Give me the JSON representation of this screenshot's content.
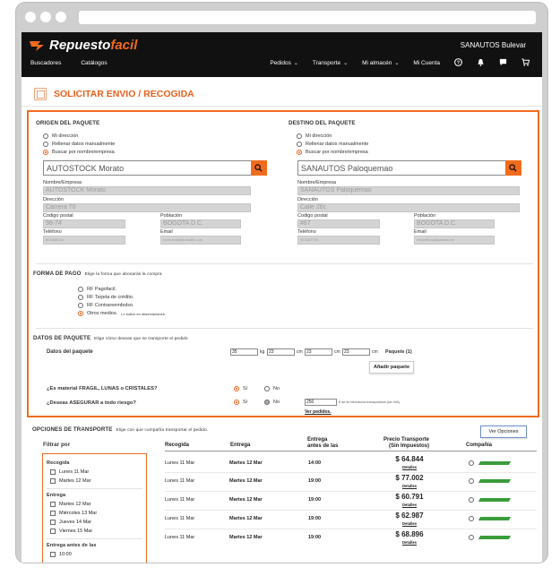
{
  "header": {
    "logo_left": "Repuesto",
    "logo_right": "facil",
    "user": "SANAUTOS Bulevar",
    "nav_left": [
      "Buscadores",
      "Catálogos"
    ],
    "nav_right": [
      "Pedidos",
      "Transporte",
      "Mi almacén",
      "Mi Cuenta"
    ]
  },
  "page": {
    "title": "SOLICITAR ENVIO / RECOGIDA"
  },
  "origen": {
    "title": "ORIGEN DEL PAQUETE",
    "options": [
      "Mi dirección",
      "Rellenar datos manualmente",
      "Buscar por nombre/empresa"
    ],
    "selected": 2,
    "search_value": "AUTOSTOCK Morato",
    "labels": {
      "nombre": "Nombre/Empresa",
      "direccion": "Dirección",
      "cp": "Codigo postal",
      "poblacion": "Población",
      "telefono": "Teléfono",
      "email": "Email"
    },
    "values": {
      "nombre": "AUTOSTOCK Morato",
      "direccion": "Carrera 70",
      "cp": "98-74",
      "poblacion": "BOGOTA D.C.",
      "telefono": "602488002",
      "email": "comercial@autos88.com"
    }
  },
  "destino": {
    "title": "DESTINO DEL PAQUETE",
    "options": [
      "Mi dirección",
      "Rellenar datos manualmente",
      "Buscar por nombre/empresa"
    ],
    "selected": 2,
    "search_value": "SANAUTOS Paloquemao",
    "labels": {
      "nombre": "Nombre/Empresa",
      "direccion": "Dirección",
      "cp": "Codigo postal",
      "poblacion": "Población",
      "telefono": "Teléfono",
      "email": "Email"
    },
    "values": {
      "nombre": "SANAUTOS Paloquemao",
      "direccion": "Calle 26c",
      "cp": "#67",
      "poblacion": "BOGOTA D.C.",
      "telefono": "913267700",
      "email": "recambios@sanauto.es"
    }
  },
  "pago": {
    "title": "FORMA DE PAGO",
    "subtitle": "Elige la forma que abonarás la compra",
    "options": [
      "RF Pagofacil.",
      "RF Tarjeta de crédito.",
      "RF Contrareembolso.",
      "Otros medios."
    ],
    "other_note": "Lo indico en observaciones.",
    "selected": 3
  },
  "paquete": {
    "title": "DATOS DE PAQUETE",
    "subtitle": "Elige cómo deseas que se transporte el pedido",
    "row_label": "Datos del paquete",
    "weight": "35",
    "weight_unit": "kg",
    "dims": [
      "23",
      "23",
      "23"
    ],
    "dim_unit": "cm",
    "count_label": "Paquete (1)",
    "add_button": "Añadir paquete",
    "fragil_q": "¿Es material FRAGIL, LUNAS o CRISTALES?",
    "asegurar_q": "¿Deseas ASEGURAR a todo riesgo?",
    "yes": "Sí",
    "no": "No",
    "insure_value": "250",
    "insure_note": "€ de la mercancía transportada (sin IVA).",
    "details_link": "Ver pedidos."
  },
  "transporte": {
    "title": "OPCIONES DE TRANSPORTE",
    "subtitle": "Elige con que compañía transportar el pedido.",
    "ver_opciones": "Ver Opciones",
    "filter_title": "Filtrar por",
    "filters": {
      "recogida_title": "Recogida",
      "recogida": [
        "Lunes 11 Mar",
        "Martes 12 Mar"
      ],
      "entrega_title": "Entrega",
      "entrega": [
        "Martes 12 Mar",
        "Miércoles 13 Mar",
        "Jueves 14 Mar",
        "Viernes 15 Mar"
      ],
      "antes_title": "Entrega antes de las",
      "antes": [
        "10:00"
      ]
    },
    "headers": {
      "recogida": "Recogida",
      "entrega": "Entrega",
      "antes1": "Entrega",
      "antes2": "antes de las",
      "precio1": "Precio Transporte",
      "precio2": "(Sin Impuestos)",
      "compania": "Compañía"
    },
    "detalles": "Detalles",
    "rows": [
      {
        "recogida": "Lunes 11 Mar",
        "entrega": "Martes 12 Mar",
        "hora": "14:00",
        "precio": "$ 64.844"
      },
      {
        "recogida": "Lunes 11 Mar",
        "entrega": "Martes 12 Mar",
        "hora": "19:00",
        "precio": "$ 77.002"
      },
      {
        "recogida": "Lunes 11 Mar",
        "entrega": "Martes 12 Mar",
        "hora": "19:00",
        "precio": "$ 60.791"
      },
      {
        "recogida": "Lunes 11 Mar",
        "entrega": "Martes 12 Mar",
        "hora": "19:00",
        "precio": "$ 62.987"
      },
      {
        "recogida": "Lunes 11 Mar",
        "entrega": "Martes 12 Mar",
        "hora": "19:00",
        "precio": "$ 68.896"
      }
    ]
  },
  "colors": {
    "accent": "#f26b1d",
    "topbar": "#111111",
    "company_logo": "#3a9c3a"
  }
}
